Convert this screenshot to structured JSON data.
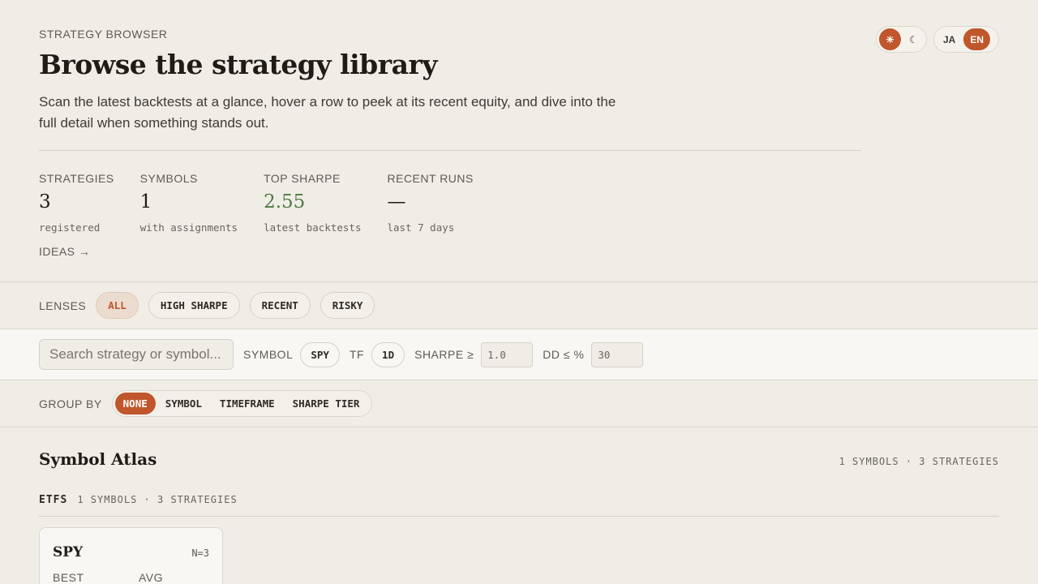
{
  "header": {
    "eyebrow": "STRATEGY BROWSER",
    "title": "Browse the strategy library",
    "description": "Scan the latest backtests at a glance, hover a row to peek at its recent equity, and dive into the full detail when something stands out."
  },
  "theme_toggle": {
    "light_icon": "sun-icon",
    "light_glyph": "☀",
    "dark_icon": "moon-icon",
    "dark_glyph": "☾",
    "active": "light"
  },
  "lang_toggle": {
    "ja": "JA",
    "en": "EN",
    "active": "EN"
  },
  "stats": [
    {
      "label": "STRATEGIES",
      "value": "3",
      "sub": "registered"
    },
    {
      "label": "SYMBOLS",
      "value": "1",
      "sub": "with assignments"
    },
    {
      "label": "TOP SHARPE",
      "value": "2.55",
      "sub": "latest backtests"
    },
    {
      "label": "RECENT RUNS",
      "value": "—",
      "sub": "last 7 days"
    }
  ],
  "ideas_link": "IDEAS →",
  "lenses": {
    "label": "LENSES",
    "items": [
      "ALL",
      "HIGH SHARPE",
      "RECENT",
      "RISKY"
    ],
    "active": "ALL"
  },
  "filters": {
    "search_placeholder": "Search strategy or symbol...",
    "symbol_label": "SYMBOL",
    "symbol_value": "SPY",
    "tf_label": "TF",
    "tf_value": "1D",
    "sharpe_label": "SHARPE ≥",
    "sharpe_placeholder": "1.0",
    "dd_label": "DD ≤ %",
    "dd_placeholder": "30"
  },
  "groupby": {
    "label": "GROUP BY",
    "items": [
      "NONE",
      "SYMBOL",
      "TIMEFRAME",
      "SHARPE TIER"
    ],
    "active": "NONE"
  },
  "atlas": {
    "title": "Symbol Atlas",
    "meta": "1 SYMBOLS · 3 STRATEGIES",
    "groups": [
      {
        "name": "ETFS",
        "meta": "1 SYMBOLS · 3 STRATEGIES",
        "cards": [
          {
            "symbol": "SPY",
            "n": "N=3",
            "best_label": "BEST",
            "avg_label": "AVG"
          }
        ]
      }
    ]
  },
  "colors": {
    "accent": "#c0562b",
    "positive": "#4f7a40",
    "background": "#f0ede6"
  }
}
